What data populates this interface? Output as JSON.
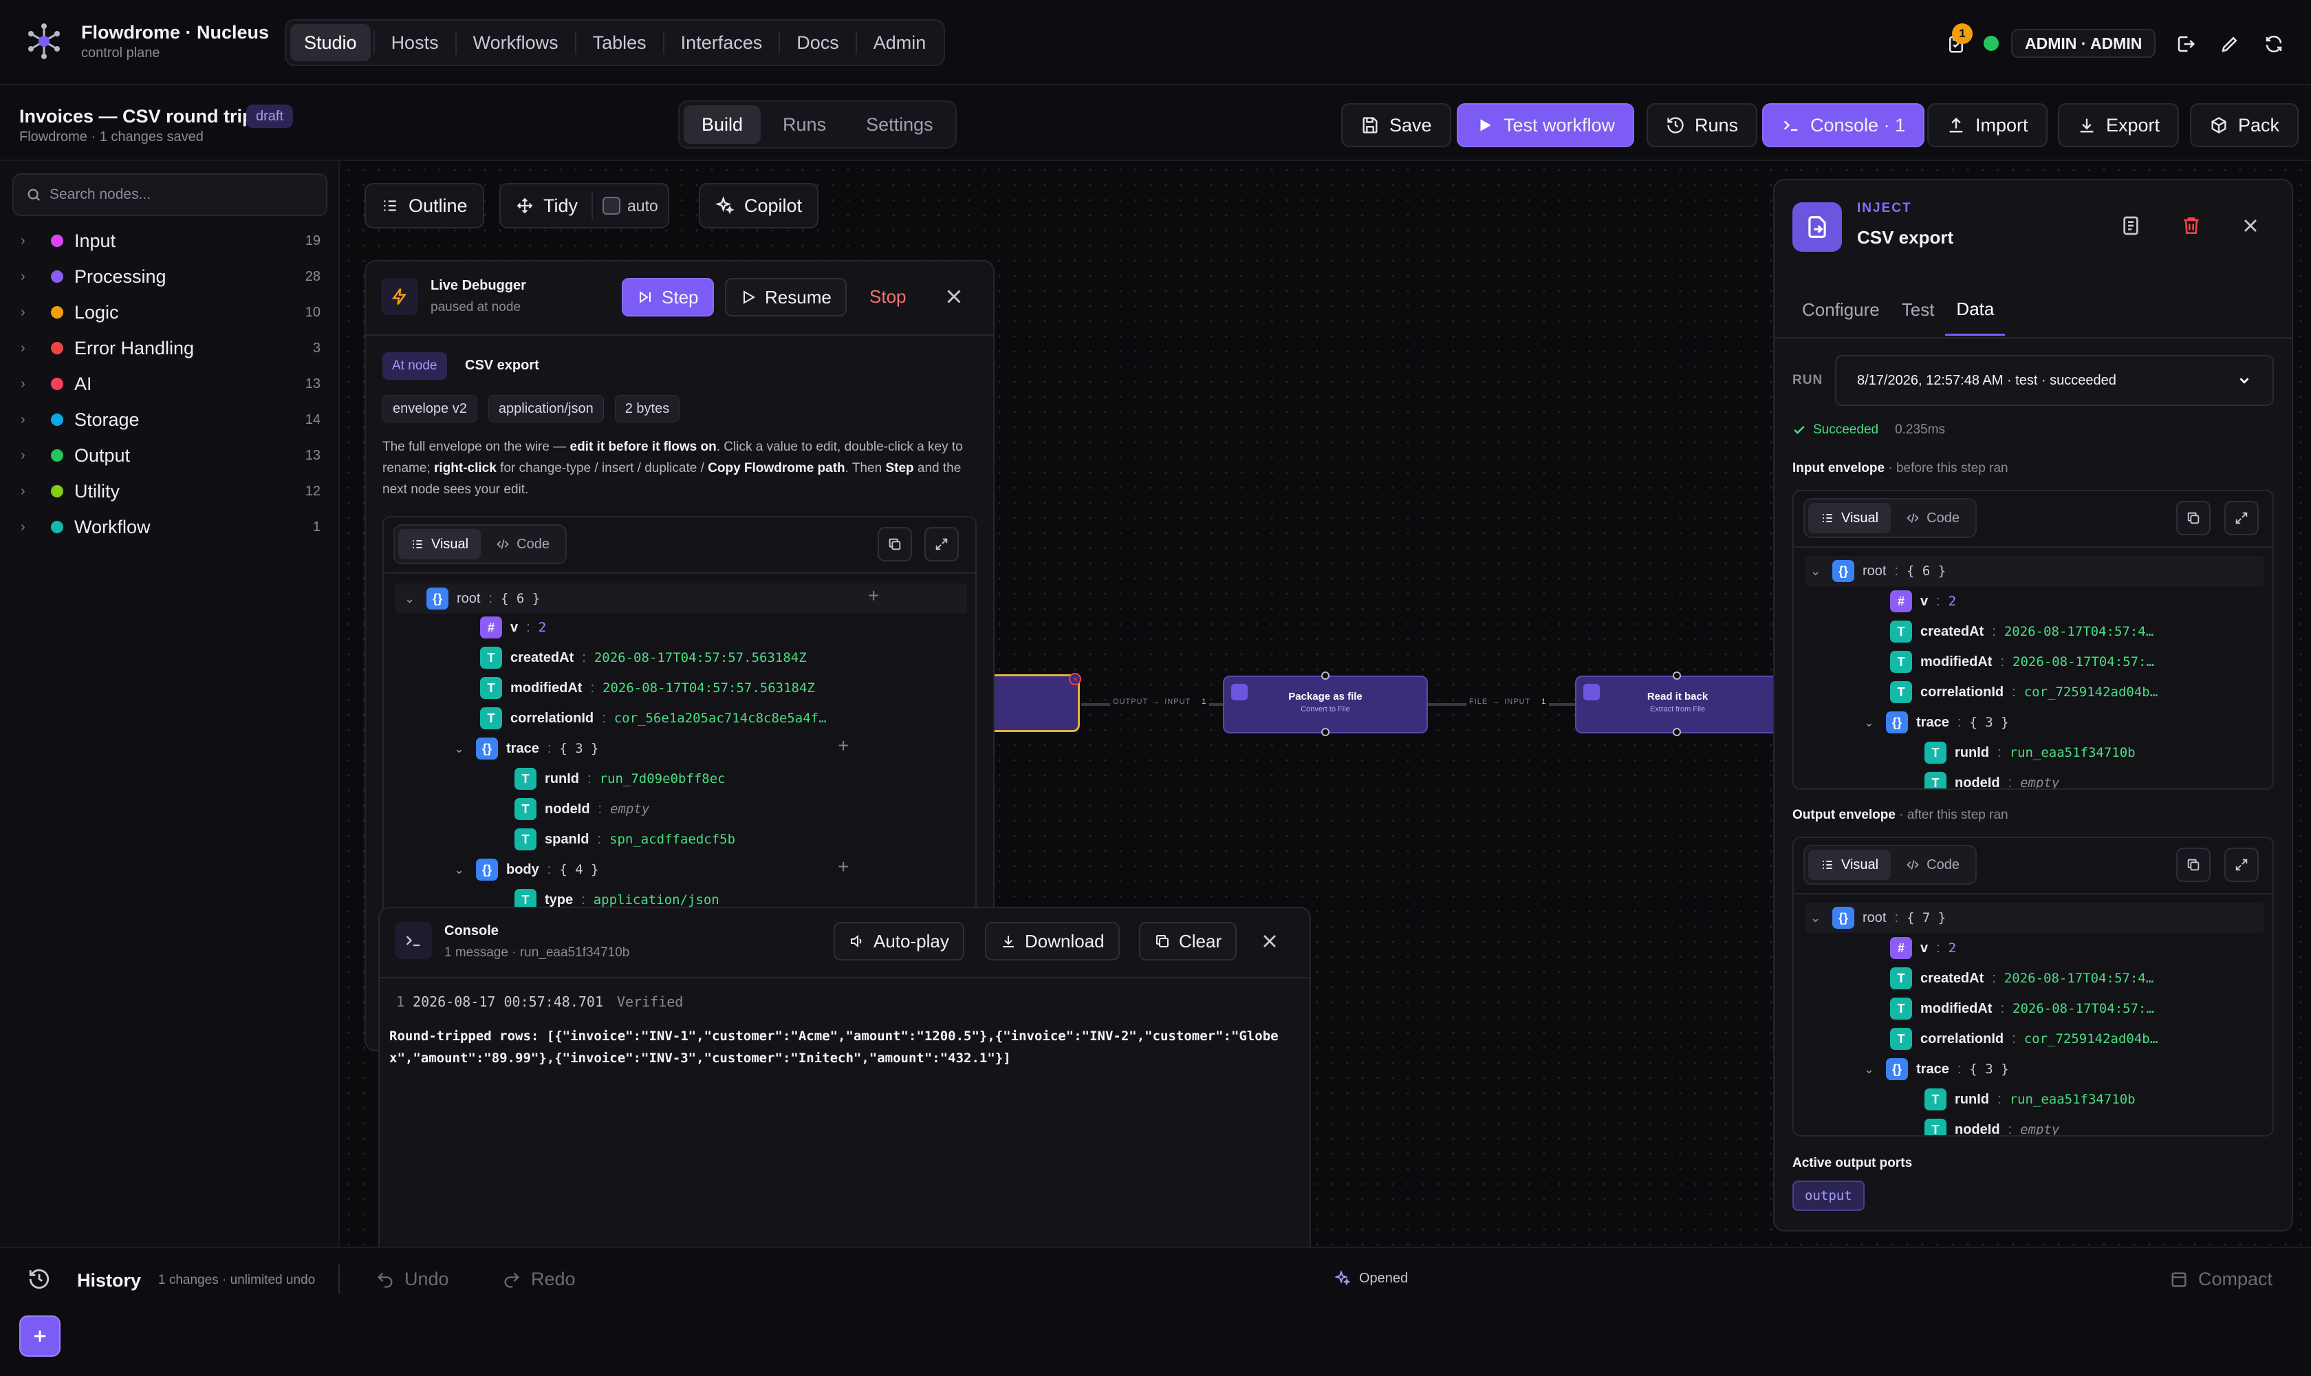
{
  "app": {
    "name": "Flowdrome · Nucleus",
    "subtitle": "control plane"
  },
  "nav": {
    "tabs": [
      "Studio",
      "Hosts",
      "Workflows",
      "Tables",
      "Interfaces",
      "Docs",
      "Admin"
    ],
    "active": "Studio"
  },
  "topbar": {
    "notification_count": "1",
    "user": "ADMIN · ADMIN"
  },
  "workflow": {
    "title": "Invoices — CSV round trip",
    "badge": "draft",
    "subtitle": "Flowdrome · 1 changes saved"
  },
  "modes": {
    "tabs": [
      "Build",
      "Runs",
      "Settings"
    ],
    "active": "Build"
  },
  "actions": {
    "save": "Save",
    "test": "Test workflow",
    "runs": "Runs",
    "console": "Console · 1",
    "import": "Import",
    "export": "Export",
    "pack": "Pack"
  },
  "sidebar": {
    "search_placeholder": "Search nodes...",
    "categories": [
      {
        "label": "Input",
        "count": "19",
        "color": "#d946ef"
      },
      {
        "label": "Processing",
        "count": "28",
        "color": "#8b5cf6"
      },
      {
        "label": "Logic",
        "count": "10",
        "color": "#f59e0b"
      },
      {
        "label": "Error Handling",
        "count": "3",
        "color": "#ef4444"
      },
      {
        "label": "AI",
        "count": "13",
        "color": "#f43f5e"
      },
      {
        "label": "Storage",
        "count": "14",
        "color": "#0ea5e9"
      },
      {
        "label": "Output",
        "count": "13",
        "color": "#22c55e"
      },
      {
        "label": "Utility",
        "count": "12",
        "color": "#84cc16"
      },
      {
        "label": "Workflow",
        "count": "1",
        "color": "#14b8a6"
      }
    ]
  },
  "canvas_tools": {
    "outline": "Outline",
    "tidy": "Tidy",
    "auto": "auto",
    "copilot": "Copilot"
  },
  "flow": {
    "nodes": [
      {
        "title": "Package as file",
        "subtitle": "Convert to File"
      },
      {
        "title": "Read it back",
        "subtitle": "Extract from File"
      }
    ],
    "edges": [
      {
        "from": "OUTPUT",
        "to": "INPUT",
        "count": "1"
      },
      {
        "from": "FILE",
        "to": "INPUT",
        "count": "1"
      }
    ]
  },
  "debugger": {
    "title": "Live Debugger",
    "status": "paused at node",
    "step": "Step",
    "resume": "Resume",
    "stop": "Stop",
    "at_node_label": "At node",
    "node_name": "CSV export",
    "chips": [
      "envelope v2",
      "application/json",
      "2 bytes"
    ],
    "help": {
      "p1": "The full envelope on the wire — ",
      "b1": "edit it before it flows on",
      "p2": ". Click a value to edit, double-click a key to rename; ",
      "b2": "right-click",
      "p3": " for change-type / insert / duplicate / ",
      "b3": "Copy Flowdrome path",
      "p4": ". Then ",
      "b4": "Step",
      "p5": " and the next node sees your edit."
    },
    "view_tabs": [
      "Visual",
      "Code"
    ],
    "tree": {
      "root_key": "root",
      "root_count": "{ 6 }",
      "v": "2",
      "createdAt": "2026-08-17T04:57:57.563184Z",
      "modifiedAt": "2026-08-17T04:57:57.563184Z",
      "correlationId": "cor_56e1a205ac714c8c8e5a4f…",
      "trace_count": "{ 3 }",
      "runId": "run_7d09e0bff8ec",
      "nodeId": "empty",
      "spanId": "spn_acdffaedcf5b",
      "body_count": "{ 4 }",
      "type_key": "type",
      "type_val": "application/json"
    }
  },
  "console": {
    "title": "Console",
    "meta": "1 message · run_eaa51f34710b",
    "autoplay": "Auto-play",
    "download": "Download",
    "clear": "Clear",
    "line_no": "1",
    "timestamp": "2026-08-17 00:57:48.701",
    "tag": "Verified",
    "message": "Round-tripped rows: [{\"invoice\":\"INV-1\",\"customer\":\"Acme\",\"amount\":\"1200.5\"},{\"invoice\":\"INV-2\",\"customer\":\"Globex\",\"amount\":\"89.99\"},{\"invoice\":\"INV-3\",\"customer\":\"Initech\",\"amount\":\"432.1\"}]"
  },
  "inspector": {
    "kind": "INJECT",
    "name": "CSV export",
    "tabs": [
      "Configure",
      "Test",
      "Data"
    ],
    "active_tab": "Data",
    "run_label": "RUN",
    "run_value": "8/17/2026, 12:57:48 AM · test · succeeded",
    "status": "Succeeded",
    "duration": "0.235ms",
    "input_title": "Input envelope",
    "input_sub": " · before this step ran",
    "output_title": "Output envelope",
    "output_sub": " · after this step ran",
    "view_tabs": [
      "Visual",
      "Code"
    ],
    "input_tree": {
      "root_count": "{ 6 }",
      "v": "2",
      "createdAt": "2026-08-17T04:57:4…",
      "modifiedAt": "2026-08-17T04:57:…",
      "correlationId": "cor_7259142ad04b…",
      "trace_count": "{ 3 }",
      "runId": "run_eaa51f34710b",
      "nodeId": "empty"
    },
    "output_tree": {
      "root_count": "{ 7 }",
      "v": "2",
      "createdAt": "2026-08-17T04:57:4…",
      "modifiedAt": "2026-08-17T04:57:…",
      "correlationId": "cor_7259142ad04b…",
      "trace_count": "{ 3 }",
      "runId": "run_eaa51f34710b",
      "nodeId": "empty"
    },
    "ports_title": "Active output ports",
    "port": "output"
  },
  "history": {
    "title": "History",
    "meta": "1 changes · unlimited undo",
    "undo": "Undo",
    "redo": "Redo",
    "status": "Opened",
    "compact": "Compact"
  }
}
